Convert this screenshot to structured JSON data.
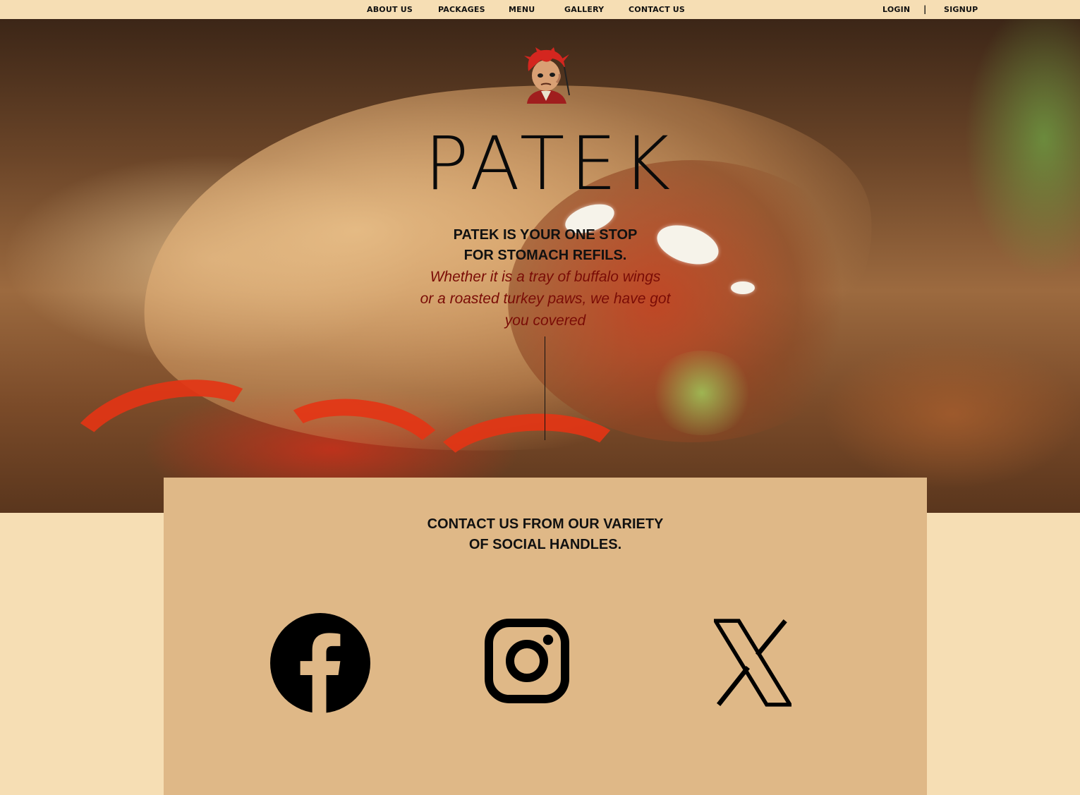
{
  "nav": {
    "links": [
      {
        "label": "ABOUT US"
      },
      {
        "label": "PACKAGES"
      },
      {
        "label": "MENU"
      },
      {
        "label": "GALLERY"
      },
      {
        "label": "CONTACT US"
      }
    ],
    "login_label": "LOGIN",
    "separator": "|",
    "signup_label": "SIGNUP"
  },
  "hero": {
    "brand": "PATEK",
    "tagline_line1": "PATEK IS YOUR ONE STOP",
    "tagline_line2": "FOR STOMACH REFILS.",
    "subtag_line1": "Whether it is a tray of buffalo wings",
    "subtag_line2": "or a roasted turkey paws, we have got",
    "subtag_line3": "you covered"
  },
  "contact": {
    "title_line1": "CONTACT US FROM OUR VARIETY",
    "title_line2": "OF SOCIAL HANDLES."
  },
  "icons": {
    "mascot": "mascot-logo",
    "facebook": "facebook-icon",
    "instagram": "instagram-icon",
    "x": "x-icon"
  },
  "colors": {
    "page_bg": "#f6deb4",
    "panel_bg": "#dfb887",
    "subtag_text": "#7a0c06"
  }
}
